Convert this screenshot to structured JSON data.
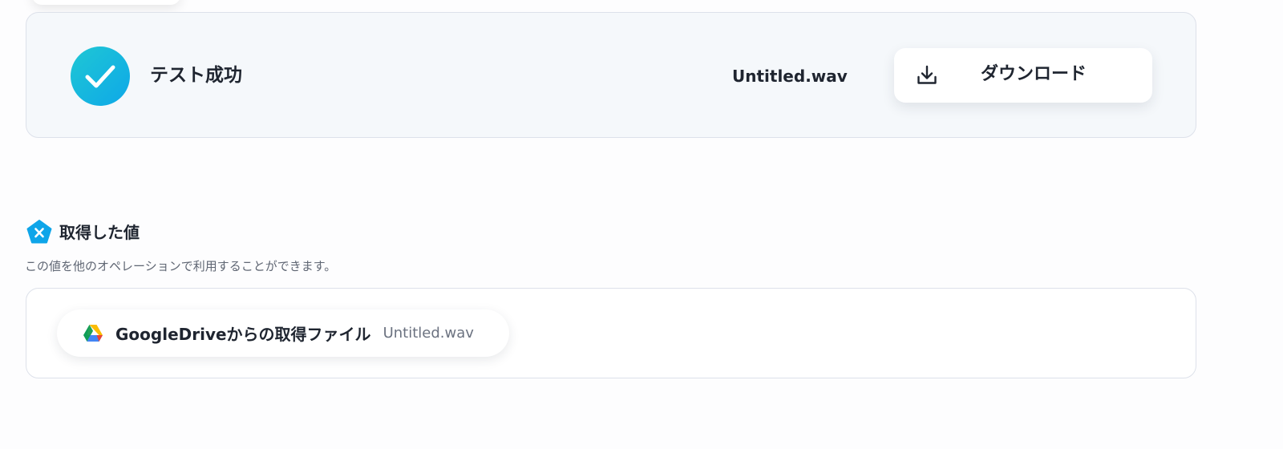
{
  "test_result": {
    "status_label": "テスト成功",
    "file_name": "Untitled.wav",
    "download_label": "ダウンロード",
    "status_color": "#14b8e6"
  },
  "acquired_values": {
    "title": "取得した値",
    "description": "この値を他のオペレーションで利用することができます。",
    "badge_color": "#0ea5e9",
    "items": [
      {
        "icon": "google-drive-icon",
        "label": "GoogleDriveからの取得ファイル",
        "value": "Untitled.wav"
      }
    ]
  }
}
